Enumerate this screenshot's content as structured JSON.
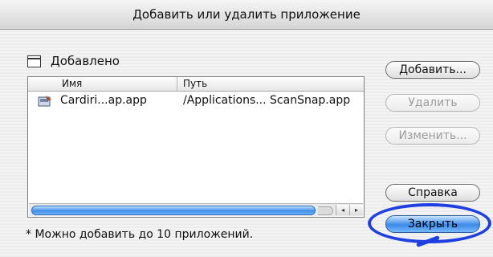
{
  "window": {
    "title": "Добавить или удалить приложение"
  },
  "section": {
    "label": "Добавлено",
    "icon": "window-icon"
  },
  "list": {
    "columns": [
      "Имя",
      "Путь"
    ],
    "rows": [
      {
        "name": "Cardiri...ap.app",
        "path": "/Applications... ScanSnap.app",
        "icon": "app-icon"
      }
    ]
  },
  "buttons": {
    "add": "Добавить...",
    "remove": "Удалить",
    "edit": "Изменить...",
    "help": "Справка",
    "close": "Закрыть"
  },
  "note": "* Можно добавить до 10 приложений.",
  "colors": {
    "accent": "#3b8ae8",
    "highlight": "#1f3fe0"
  },
  "icons": {
    "scroll_left": "◂",
    "scroll_right": "▸"
  }
}
